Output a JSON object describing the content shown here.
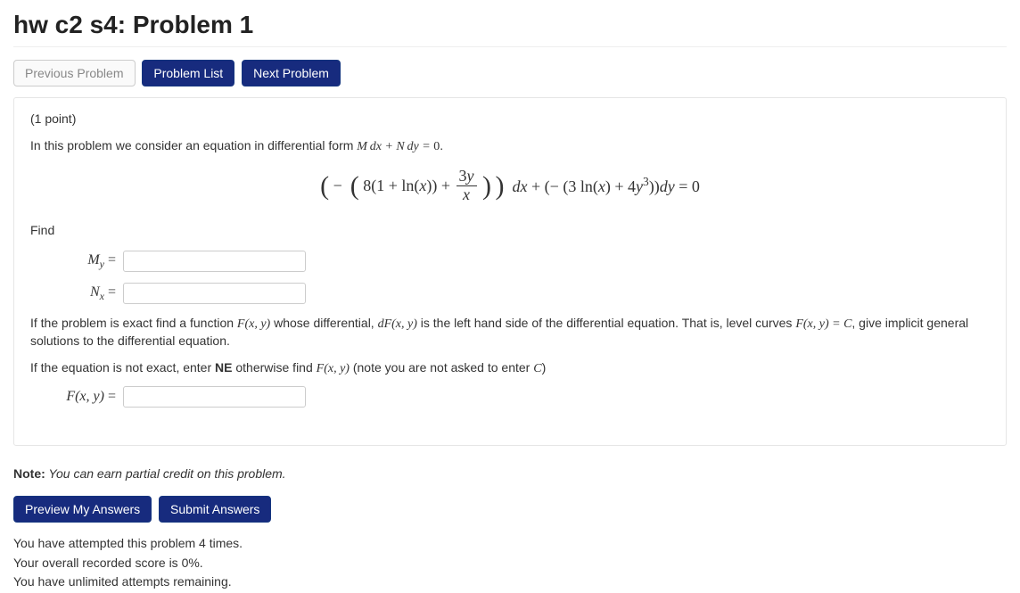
{
  "page": {
    "title": "hw c2 s4: Problem 1"
  },
  "nav": {
    "prev": "Previous Problem",
    "list": "Problem List",
    "next": "Next Problem"
  },
  "problem": {
    "points": "(1 point)",
    "intro_prefix": "In this problem we consider an equation in differential form ",
    "intro_equation": "M dx + N dy = 0",
    "intro_suffix": ".",
    "display_equation": "( − ( 8(1 + ln(x)) + 3y / x ) ) dx + ( − ( 3 ln(x) + 4y³ ) ) dy = 0",
    "find_label": "Find",
    "answers": {
      "My_label": "M_y =",
      "Nx_label": "N_x =",
      "Fxy_label": "F(x, y) ="
    },
    "para1_a": "If the problem is exact find a function ",
    "para1_f": "F(x, y)",
    "para1_b": " whose differential, ",
    "para1_df": "dF(x, y)",
    "para1_c": " is the left hand side of the differential equation. That is, level curves ",
    "para1_eq": "F(x, y) = C",
    "para1_d": ", give implicit general solutions to the differential equation.",
    "para2_a": "If the equation is not exact, enter ",
    "para2_ne": "NE",
    "para2_b": " otherwise find ",
    "para2_f": "F(x, y)",
    "para2_c": " (note you are not asked to enter ",
    "para2_cc": "C",
    "para2_d": ")"
  },
  "note": {
    "label": "Note:",
    "text": " You can earn partial credit on this problem."
  },
  "actions": {
    "preview": "Preview My Answers",
    "submit": "Submit Answers"
  },
  "status": {
    "attempts": "You have attempted this problem 4 times.",
    "score": "Your overall recorded score is 0%.",
    "remaining": "You have unlimited attempts remaining."
  }
}
